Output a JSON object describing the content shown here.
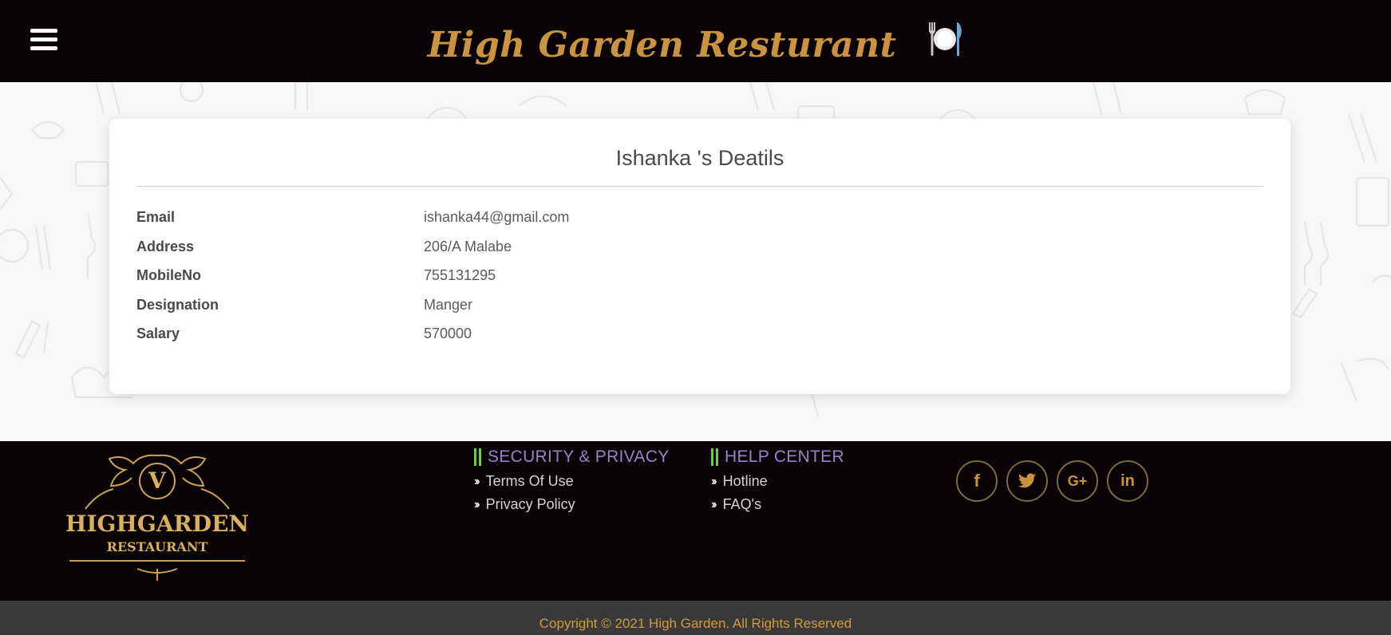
{
  "header": {
    "brand": "High Garden Resturant",
    "menu_icon": "hamburger-icon",
    "brand_icon": "fork-plate-knife-icon"
  },
  "card": {
    "title": "Ishanka 's Deatils",
    "rows": [
      {
        "label": "Email",
        "value": "ishanka44@gmail.com"
      },
      {
        "label": "Address",
        "value": "206/A Malabe"
      },
      {
        "label": "MobileNo",
        "value": "755131295"
      },
      {
        "label": "Designation",
        "value": "Manger"
      },
      {
        "label": "Salary",
        "value": "570000"
      }
    ]
  },
  "footer": {
    "logo": {
      "letter": "V",
      "line1": "HIGHGARDEN",
      "line2": "RESTAURANT"
    },
    "security": {
      "heading": "SECURITY & PRIVACY",
      "links": [
        "Terms Of Use",
        "Privacy Policy"
      ]
    },
    "help": {
      "heading": "HELP CENTER",
      "links": [
        "Hotline",
        "FAQ's"
      ]
    },
    "socials": [
      {
        "icon": "facebook-icon",
        "glyph": "f"
      },
      {
        "icon": "twitter-icon",
        "glyph": "t"
      },
      {
        "icon": "google-plus-icon",
        "glyph": "G+"
      },
      {
        "icon": "linkedin-icon",
        "glyph": "in"
      }
    ]
  },
  "copyright": "Copyright © 2021 High Garden. All Rights Reserved",
  "colors": {
    "header_bg": "#0a0305",
    "brand_gold": "#c9933f",
    "heading_purple": "#8e86c9",
    "accent_green": "#6ad13a",
    "copyright_bar": "#3a3a3a"
  }
}
